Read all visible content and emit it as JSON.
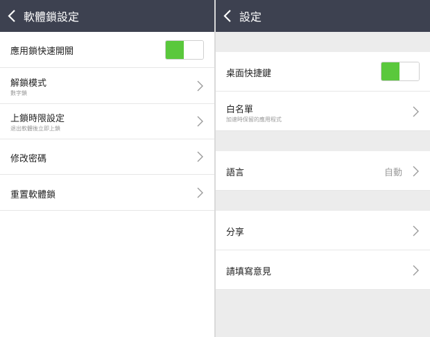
{
  "left": {
    "title": "軟體鎖設定",
    "items": [
      {
        "label": "應用鎖快速開關",
        "toggle": "on"
      },
      {
        "label": "解鎖模式",
        "sub": "數字鎖"
      },
      {
        "label": "上鎖時限設定",
        "sub": "退出軟體後立即上鎖"
      },
      {
        "label": "修改密碼"
      },
      {
        "label": "重置軟體鎖"
      }
    ]
  },
  "right": {
    "title": "設定",
    "items": [
      {
        "label": "桌面快捷鍵",
        "toggle": "on"
      },
      {
        "label": "白名單",
        "sub": "加速時保留的應用程式"
      },
      {
        "label": "語言",
        "value": "自動"
      },
      {
        "label": "分享"
      },
      {
        "label": "請填寫意見"
      }
    ]
  },
  "colors": {
    "topbar": "#3d4150",
    "toggle_on": "#5ac83c",
    "section_gap": "#ececec"
  },
  "icons": {
    "back": "chevron-left-icon",
    "row_arrow": "chevron-right-icon"
  }
}
